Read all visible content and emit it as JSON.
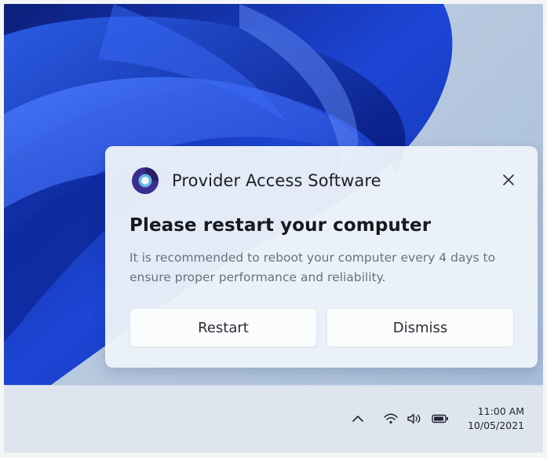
{
  "notification": {
    "app_name": "Provider Access Software",
    "title": "Please restart your computer",
    "body": "It is recommended to reboot your computer every 4 days to ensure proper performance and reliability.",
    "primary_button": "Restart",
    "secondary_button": "Dismiss",
    "close_icon": "close-icon",
    "logo_colors": {
      "outer": "#3b2d8f",
      "inner": "#5fb6e3"
    }
  },
  "taskbar": {
    "tray_icons": [
      "chevron-up-icon",
      "wifi-icon",
      "volume-icon",
      "battery-icon"
    ],
    "time": "11:00 AM",
    "date": "10/05/2021"
  },
  "colors": {
    "wallpaper_blue": "#1a3ec8",
    "toast_bg": "#ecf2f9",
    "taskbar_bg": "#dfe5ee"
  }
}
